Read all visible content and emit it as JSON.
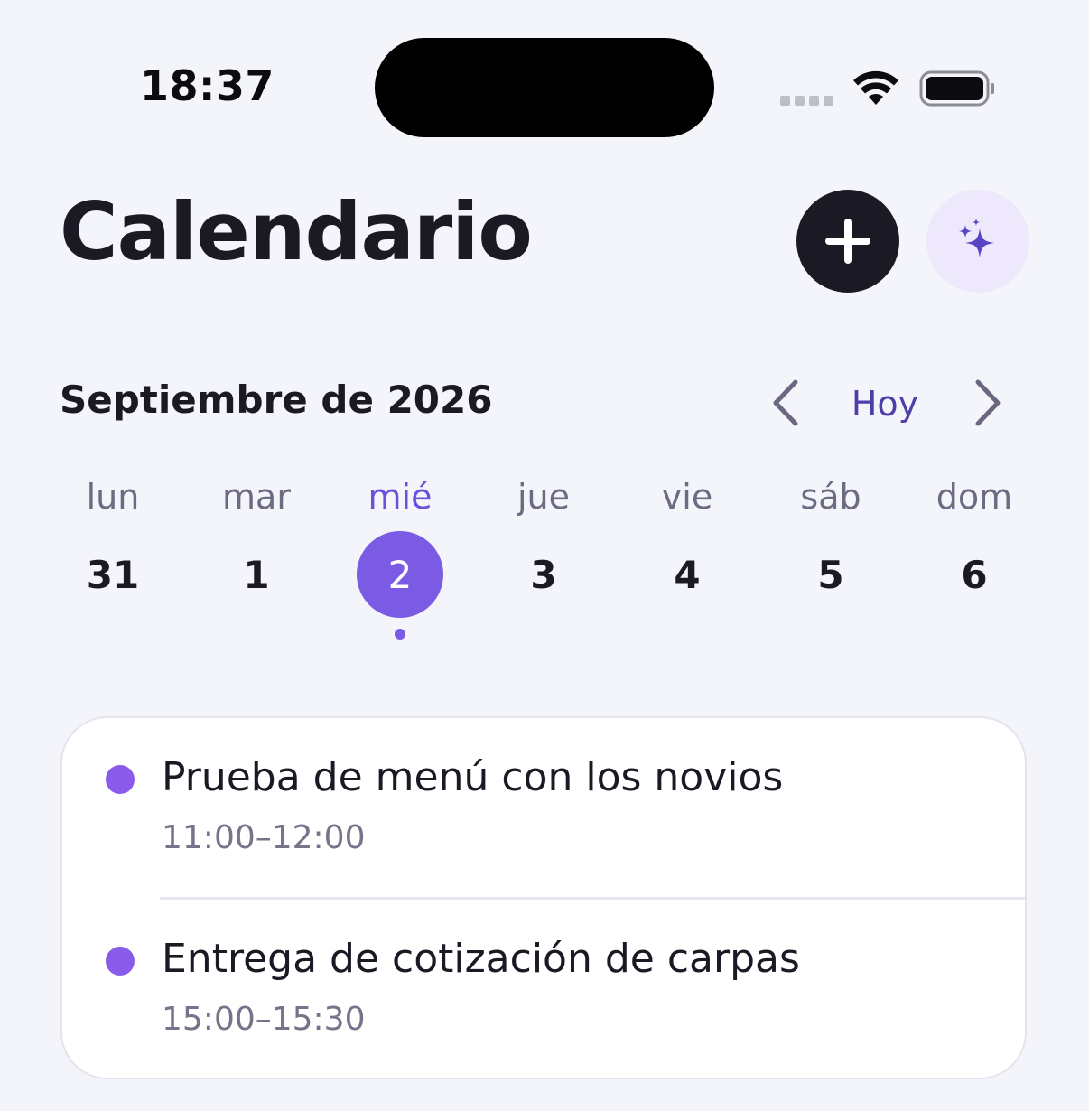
{
  "status_bar": {
    "time": "18:37"
  },
  "header": {
    "title": "Calendario",
    "add_icon": "plus-icon",
    "ai_icon": "sparkles-icon"
  },
  "month_nav": {
    "label": "Septiembre de 2026",
    "today_label": "Hoy",
    "prev_icon": "chevron-left-icon",
    "next_icon": "chevron-right-icon"
  },
  "week": {
    "days": [
      {
        "weekday": "lun",
        "number": "31",
        "selected": false,
        "has_events": false
      },
      {
        "weekday": "mar",
        "number": "1",
        "selected": false,
        "has_events": false
      },
      {
        "weekday": "mié",
        "number": "2",
        "selected": true,
        "has_events": true
      },
      {
        "weekday": "jue",
        "number": "3",
        "selected": false,
        "has_events": false
      },
      {
        "weekday": "vie",
        "number": "4",
        "selected": false,
        "has_events": false
      },
      {
        "weekday": "sáb",
        "number": "5",
        "selected": false,
        "has_events": false
      },
      {
        "weekday": "dom",
        "number": "6",
        "selected": false,
        "has_events": false
      }
    ]
  },
  "events": [
    {
      "title": "Prueba de menú con los novios",
      "time": "11:00–12:00",
      "color": "#8A5BEA"
    },
    {
      "title": "Entrega de cotización de carpas",
      "time": "15:00–15:30",
      "color": "#8A5BEA"
    }
  ],
  "colors": {
    "accent": "#7B5BE3",
    "today_text": "#4E3FA6",
    "dark": "#1B1A24",
    "background": "#F4F5FA"
  }
}
